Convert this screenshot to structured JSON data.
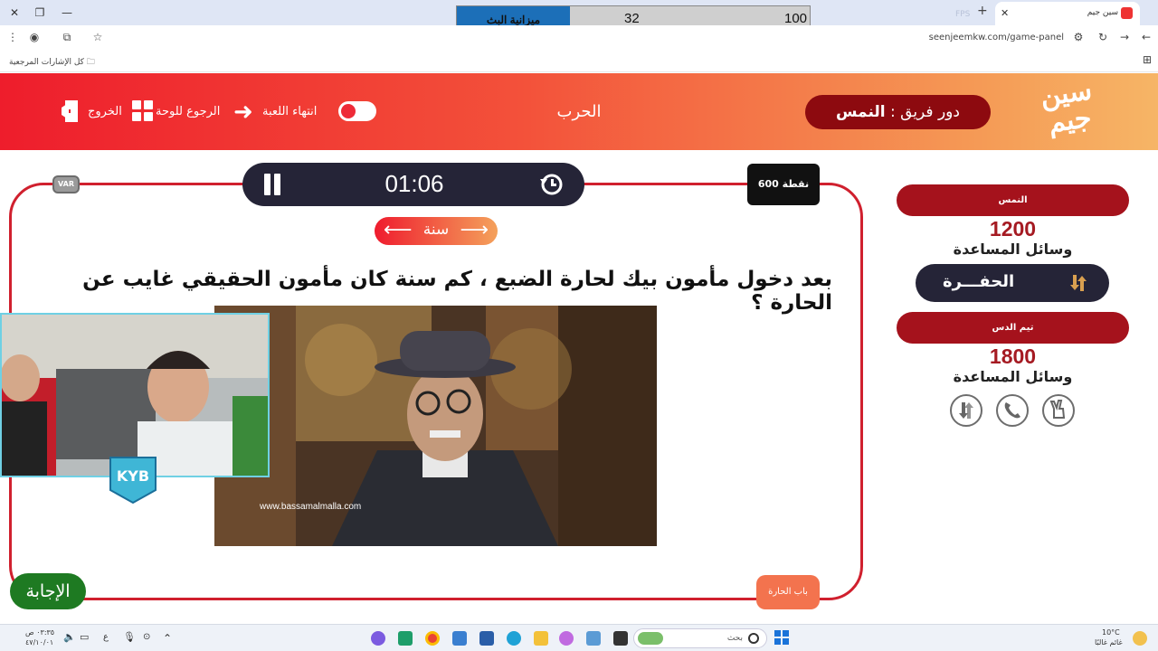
{
  "browser": {
    "tab_title": "سين جيم",
    "fps_label": "FPS",
    "url": "seenjeemkw.com/game-panel",
    "bookmarks_label": "كل الإشارات المرجعية"
  },
  "budget_widget": {
    "label": "ميزانية البث",
    "value_a": "32",
    "value_b": "100"
  },
  "header": {
    "logo_text_top": "سين",
    "logo_text_bottom": "جيم",
    "turn_prefix": "دور فريق :",
    "turn_team": "النمس",
    "category": "الحرب",
    "end_game_label": "انتهاء اللعبة",
    "back_to_board_label": "الرجوع للوحة",
    "exit_label": "الخروج"
  },
  "question_panel": {
    "timer": "01:06",
    "points": "600 نقطة",
    "var_badge": "VAR",
    "category_pill": "سنة",
    "question": "بعد دخول مأمون بيك لحارة الضبع ، كم سنة كان مأمون الحقيقي غايب عن الحارة ؟",
    "image_watermark": "www.bassamalmalla.com",
    "answer_button": "الإجابة",
    "source_tag": "باب الحارة",
    "webcam_badge": "KYB"
  },
  "teams": [
    {
      "name": "النمس",
      "score": "1200",
      "aids_label": "وسائل المساعدة",
      "active_aid": "الحفـــرة"
    },
    {
      "name": "تيم الدس",
      "score": "1800",
      "aids_label": "وسائل المساعدة"
    }
  ],
  "taskbar": {
    "search_placeholder": "بحث",
    "weather_temp": "10°C",
    "weather_desc": "غائم غالبًا",
    "time": "٠٣:٣٥ ص",
    "date": "٤٧/١٠/٠١",
    "lang": "ع"
  },
  "colors": {
    "header_red": "#ee1d2c",
    "header_orange": "#f6b566",
    "team_red": "#a5121c",
    "dark_pill": "#252437",
    "answer_green": "#1e7a22",
    "budget_blue": "#1c6fb8"
  }
}
